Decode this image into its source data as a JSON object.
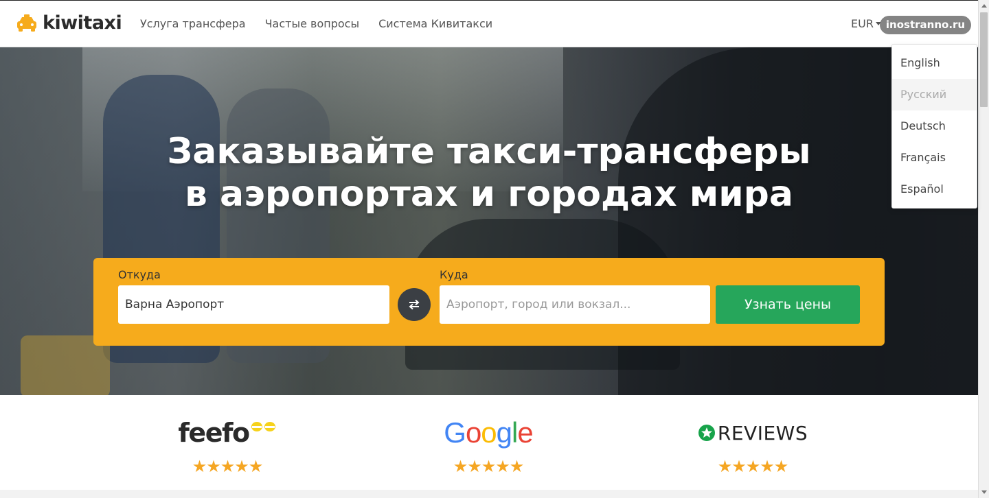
{
  "header": {
    "logo_text": "kiwitaxi",
    "nav": [
      "Услуга трансфера",
      "Частые вопросы",
      "Система Кивитакси"
    ],
    "currency": "EUR",
    "watermark": "inostranno.ru"
  },
  "language_menu": {
    "items": [
      "English",
      "Русский",
      "Deutsch",
      "Français",
      "Español"
    ],
    "active": "Русский"
  },
  "hero": {
    "title_line1": "Заказывайте такси-трансферы",
    "title_line2": "в аэропортах и городах мира"
  },
  "search": {
    "from_label": "Откуда",
    "from_value": "Варна Аэропорт",
    "to_label": "Куда",
    "to_placeholder": "Аэропорт, город или вокзал...",
    "submit_label": "Узнать цены"
  },
  "reviews": [
    {
      "name": "feefo",
      "stars": "★★★★★"
    },
    {
      "name": "Google",
      "stars": "★★★★★"
    },
    {
      "name": "REVIEWS",
      "stars": "★★★★★"
    }
  ],
  "colors": {
    "accent": "#f6ab1c",
    "cta": "#26a65b",
    "swap": "#3b3f44"
  }
}
